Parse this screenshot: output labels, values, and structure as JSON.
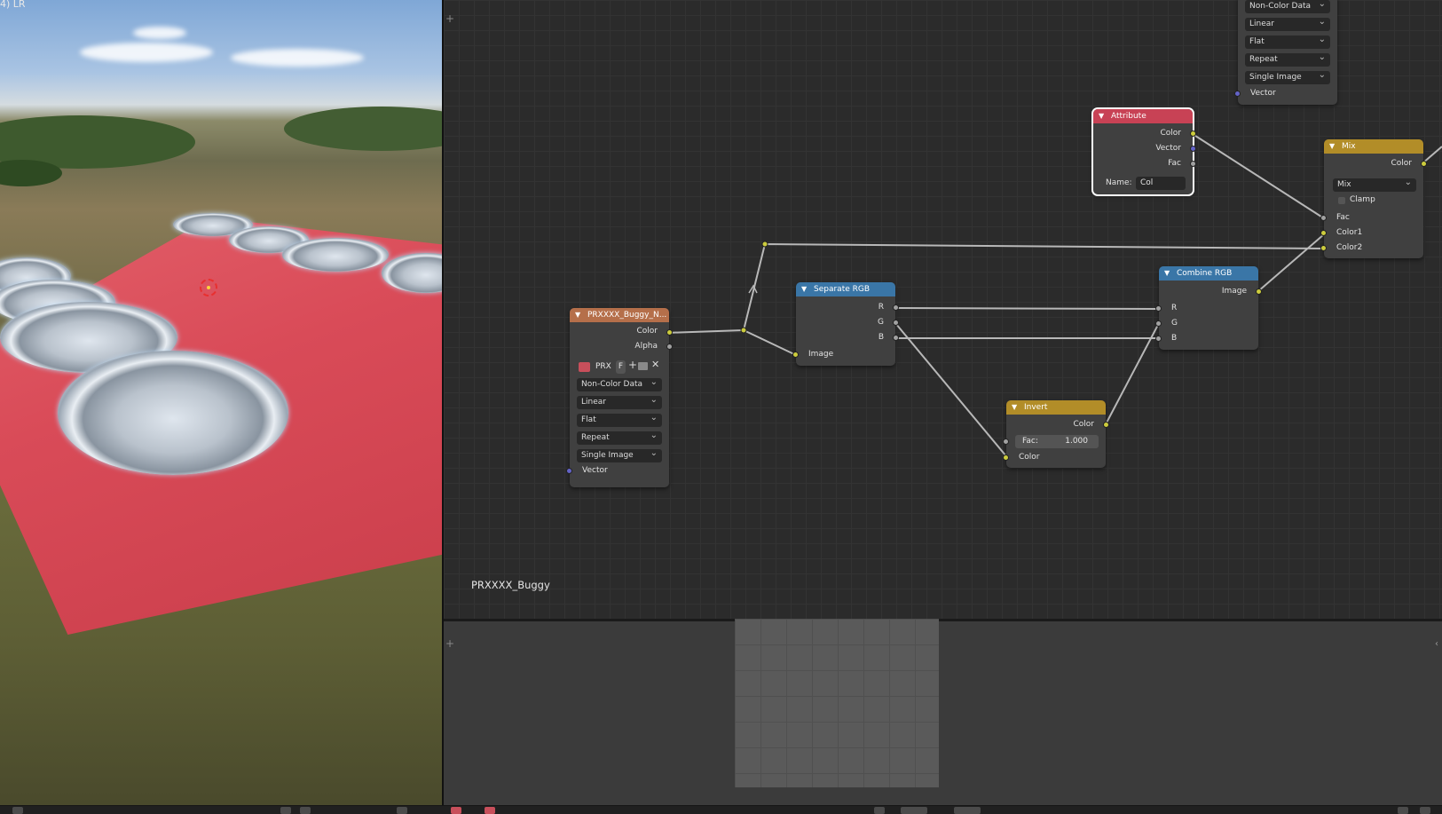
{
  "viewport": {
    "label": "4) LR"
  },
  "node_editor": {
    "material_name": "PRXXXX_Buggy",
    "image_texture_top": {
      "colorspace": "Non-Color Data",
      "interpolation": "Linear",
      "projection": "Flat",
      "extension": "Repeat",
      "source": "Single Image",
      "vector_label": "Vector"
    },
    "attribute_node": {
      "title": "Attribute",
      "outputs": [
        "Color",
        "Vector",
        "Fac"
      ],
      "name_label": "Name:",
      "name_value": "Col"
    },
    "mix_node": {
      "title": "Mix",
      "output": "Color",
      "blend_type": "Mix",
      "clamp_label": "Clamp",
      "inputs": [
        "Fac",
        "Color1",
        "Color2"
      ]
    },
    "image_texture_node": {
      "title": "PRXXXX_Buggy_N...",
      "outputs": [
        "Color",
        "Alpha"
      ],
      "image_name": "PRX",
      "fake_user": "F",
      "colorspace": "Non-Color Data",
      "interpolation": "Linear",
      "projection": "Flat",
      "extension": "Repeat",
      "source": "Single Image",
      "vector_label": "Vector"
    },
    "separate_rgb_node": {
      "title": "Separate RGB",
      "outputs": [
        "R",
        "G",
        "B"
      ],
      "input": "Image"
    },
    "combine_rgb_node": {
      "title": "Combine RGB",
      "output": "Image",
      "inputs": [
        "R",
        "G",
        "B"
      ]
    },
    "invert_node": {
      "title": "Invert",
      "output": "Color",
      "fac_label": "Fac:",
      "fac_value": "1.000",
      "input": "Color"
    }
  },
  "colors": {
    "socket_color": "#cccc3d",
    "socket_gray": "#a1a1a1",
    "socket_vector": "#6363c7",
    "header_image": "#b56f4a",
    "header_converter": "#3a76a7",
    "header_input": "#c84255",
    "header_color": "#b28d28"
  }
}
